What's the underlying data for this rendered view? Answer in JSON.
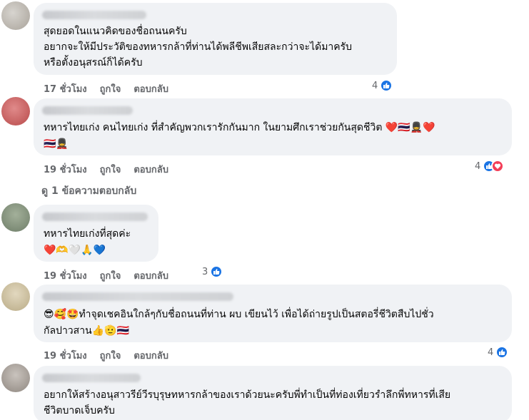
{
  "comments": [
    {
      "lines": [
        "สุดยอดในแนวคิดของชื่อถนนครับ",
        "อยากจะให้มีประวัติของทหารกล้าที่ท่านได้พลีชีพเสียสละกว่าจะได้มาครับ",
        "หรือตั้งอนุสรณ์ก็ได้ครับ"
      ],
      "time": "17 ชั่วโมง",
      "like": "ถูกใจ",
      "reply": "ตอบกลับ",
      "reactions": "4"
    },
    {
      "lines": [
        "ทหารไทยเก่ง คนไทยเก่ง ที่สำคัญพวกเรารักกันมาก ในยามศึกเราช่วยกันสุดชีวิต ❤️🇹🇭💂❤️",
        "🇹🇭💂"
      ],
      "time": "19 ชั่วโมง",
      "like": "ถูกใจ",
      "reply": "ตอบกลับ",
      "reactions": "4"
    },
    {
      "lines": [
        "ทหารไทยเก่งที่สุดค่ะ",
        "❤️🫶🤍🙏💙"
      ],
      "time": "19 ชั่วโมง",
      "like": "ถูกใจ",
      "reply": "ตอบกลับ",
      "reactions": "3"
    },
    {
      "lines": [
        "😎🥰🤩ทำจุดเชคอินใกล้ๆกับชื่อถนนที่ท่าน ผบ เขียนไว้ เพื่อได้ถ่ายรูปเป็นสตอรี่ชีวิตสืบไปชั่ว",
        "กัลปาวสาน👍🫡🇹🇭"
      ],
      "time": "19 ชั่วโมง",
      "like": "ถูกใจ",
      "reply": "ตอบกลับ",
      "reactions": "4"
    },
    {
      "lines": [
        "อยากให้สร้างอนุสาวรีย์วีรบุรุษทหารกล้าของเราด้วยนะครับพี่ทำเป็นที่ท่องเที่ยวรำลึกพี่ทหารที่เสีย",
        "ชีวิตบาดเจ็บครับ"
      ]
    }
  ],
  "view_replies": "ดู 1 ข้อความตอบกลับ",
  "colors": {
    "bubble": "#f0f2f5",
    "like": "#1b74e4",
    "love": "#f33e58",
    "meta": "#65676b"
  },
  "icons": {
    "like": "thumbs-up-icon",
    "love": "heart-icon"
  }
}
